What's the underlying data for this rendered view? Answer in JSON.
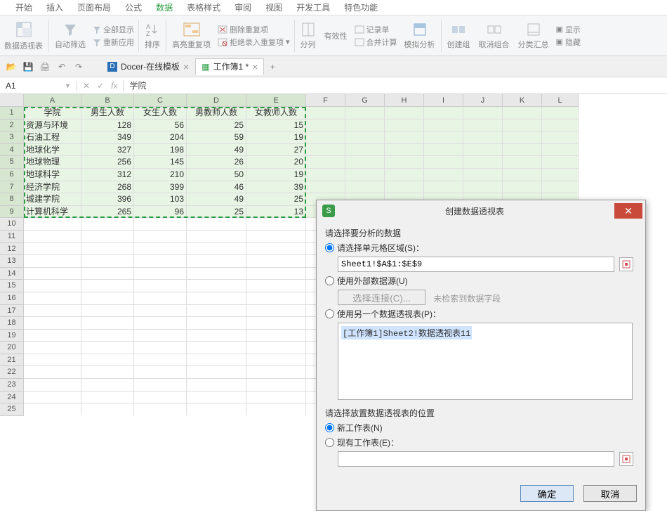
{
  "menu": [
    "开始",
    "插入",
    "页面布局",
    "公式",
    "数据",
    "表格样式",
    "审阅",
    "视图",
    "开发工具",
    "特色功能"
  ],
  "menu_active_idx": 4,
  "ribbon": {
    "pivot": "数据透视表",
    "autofilter": "自动筛选",
    "showall": "全部显示",
    "reapply": "重新应用",
    "sort": "排序",
    "highlightdup": "高亮重复项",
    "removedup": "删除重复项",
    "rejectdup": "拒绝录入重复项",
    "splitcol": "分列",
    "validation": "有效性",
    "consolidate": "记录单",
    "mergecalc": "合并计算",
    "whatif": "模拟分析",
    "group": "创建组",
    "ungroup": "取消组合",
    "subtotal": "分类汇总",
    "hidedetail": "隐藏",
    "showdetail": "显示"
  },
  "tabs": {
    "docer": "Docer-在线模板",
    "wb": "工作簿1 *"
  },
  "namebox": "A1",
  "fxvalue": "学院",
  "cols": [
    "A",
    "B",
    "C",
    "D",
    "E",
    "F",
    "G",
    "H",
    "I",
    "J",
    "K",
    "L"
  ],
  "headers": [
    "学院",
    "男生人数",
    "女生人数",
    "男教师人数",
    "女教师人数"
  ],
  "data": [
    [
      "资源与环境",
      128,
      56,
      25,
      15
    ],
    [
      "石油工程",
      349,
      204,
      59,
      19
    ],
    [
      "地球化学",
      327,
      198,
      49,
      27
    ],
    [
      "地球物理",
      256,
      145,
      26,
      20
    ],
    [
      "地球科学",
      312,
      210,
      50,
      19
    ],
    [
      "经济学院",
      268,
      399,
      46,
      39
    ],
    [
      "城建学院",
      396,
      103,
      49,
      25
    ],
    [
      "计算机科学",
      265,
      96,
      25,
      13
    ]
  ],
  "dialog": {
    "title": "创建数据透视表",
    "sec1": "请选择要分析的数据",
    "opt_range": "请选择单元格区域(S)：",
    "range_val": "Sheet1!$A$1:$E$9",
    "opt_ext": "使用外部数据源(U)",
    "choose_conn": "选择连接(C)...",
    "no_datafield": "未检索到数据字段",
    "opt_another": "使用另一个数据透视表(P)：",
    "another_item": "[工作簿1]Sheet2!数据透视表11",
    "sec2": "请选择放置数据透视表的位置",
    "opt_newsheet": "新工作表(N)",
    "opt_existing": "现有工作表(E)：",
    "ok": "确定",
    "cancel": "取消"
  }
}
